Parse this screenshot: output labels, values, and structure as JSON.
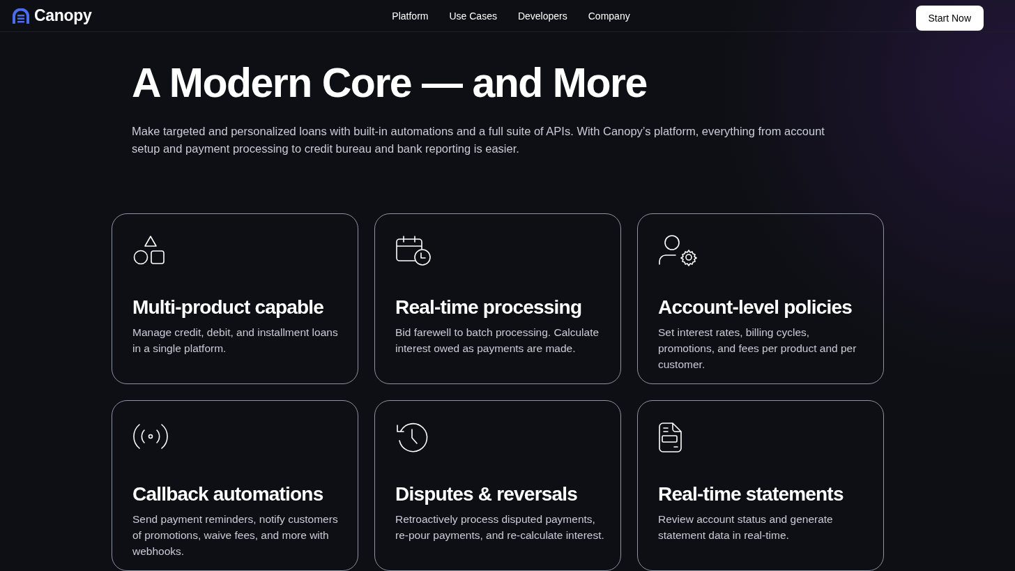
{
  "header": {
    "logo": "Canopy",
    "nav": [
      {
        "label": "Platform"
      },
      {
        "label": "Use Cases"
      },
      {
        "label": "Developers"
      },
      {
        "label": "Company"
      }
    ],
    "cta": "Start Now"
  },
  "hero": {
    "title": "A Modern Core — and More",
    "text": "Make targeted and personalized loans with built-in automations and a full suite of APIs. With Canopy’s platform, everything from account setup and payment processing to credit bureau and bank reporting is easier."
  },
  "features": [
    {
      "title": "Multi-product capable",
      "text": "Manage credit, debit, and installment loans in a single platform."
    },
    {
      "title": "Real-time processing",
      "text": "Bid farewell to batch processing. Calculate interest owed as payments are made."
    },
    {
      "title": "Account-level policies",
      "text": "Set interest rates, billing cycles, promotions, and fees per product and per customer."
    },
    {
      "title": "Callback automations",
      "text": "Send payment reminders, notify customers of promotions, waive fees, and more with webhooks."
    },
    {
      "title": "Disputes & reversals",
      "text": "Retroactively process disputed payments, re-pour payments, and re-calculate interest."
    },
    {
      "title": "Real-time statements",
      "text": "Review account status and generate statement data in real-time."
    }
  ]
}
